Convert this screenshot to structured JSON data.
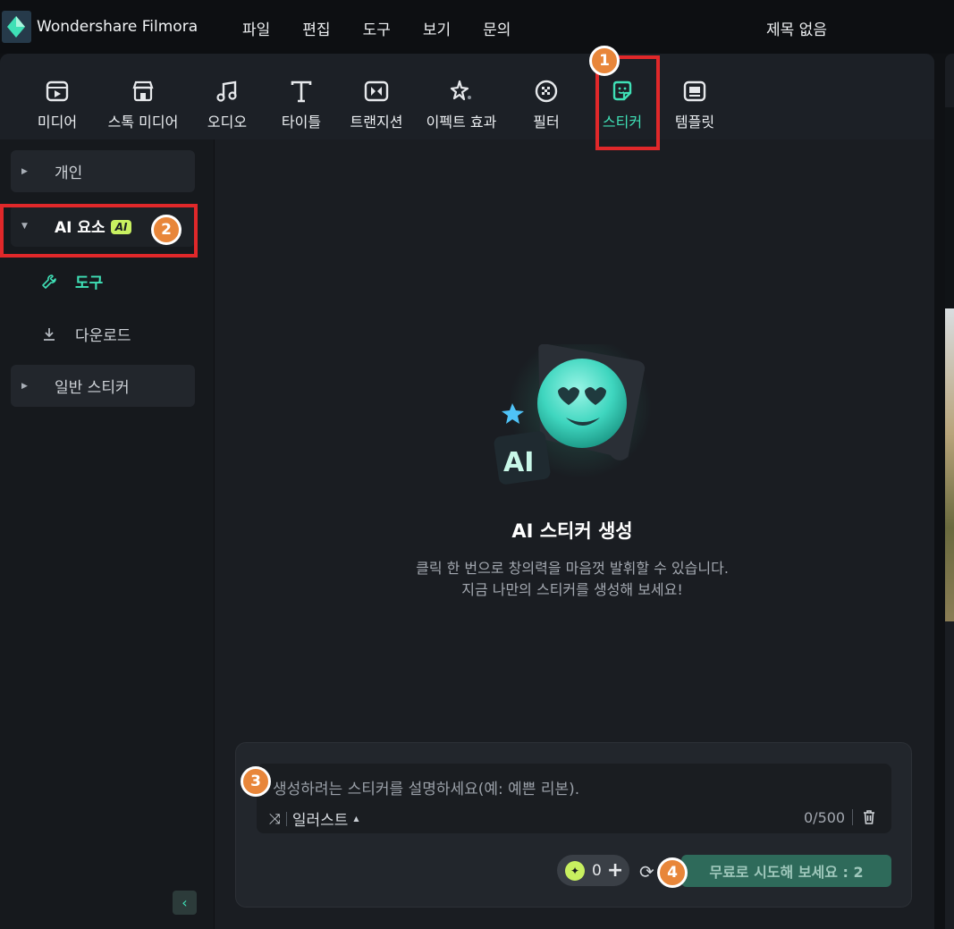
{
  "app": {
    "name": "Wondershare Filmora",
    "document_title": "제목 없음"
  },
  "menu": [
    "파일",
    "편집",
    "도구",
    "보기",
    "문의"
  ],
  "toolbar": {
    "items": [
      {
        "label": "미디어",
        "icon": "media-icon"
      },
      {
        "label": "스톡 미디어",
        "icon": "store-icon"
      },
      {
        "label": "오디오",
        "icon": "music-note-icon"
      },
      {
        "label": "타이틀",
        "icon": "text-t-icon"
      },
      {
        "label": "트랜지션",
        "icon": "transition-icon"
      },
      {
        "label": "이펙트 효과",
        "icon": "sparkle-effect-icon"
      },
      {
        "label": "필터",
        "icon": "filter-icon"
      },
      {
        "label": "스티커",
        "icon": "sticker-icon",
        "active": true
      },
      {
        "label": "템플릿",
        "icon": "template-icon"
      }
    ]
  },
  "sidebar": {
    "personal": "개인",
    "ai_elements": "AI 요소",
    "ai_badge": "AI",
    "tools": "도구",
    "download": "다운로드",
    "general_stickers": "일반 스티커",
    "collapse_glyph": "‹"
  },
  "main": {
    "hero_icon_text": "AI",
    "title": "AI 스티커 생성",
    "subtitle_line1": "클릭 한 번으로 창의력을 마음껏 발휘할 수 있습니다.",
    "subtitle_line2": "지금 나만의 스티커를 생성해 보세요!"
  },
  "generator": {
    "placeholder": "생성하려는 스티커를 설명하세요(예: 예쁜 리본).",
    "style": "일러스트",
    "counter": "0/500",
    "credits": "0",
    "try_button": "무료로 시도해 보세요 : 2"
  },
  "annotations": [
    "1",
    "2",
    "3",
    "4"
  ],
  "colors": {
    "accent": "#3fe0b6",
    "highlight_box": "#e0282a",
    "badge": "#e8863a",
    "ai_badge": "#c8f060"
  }
}
